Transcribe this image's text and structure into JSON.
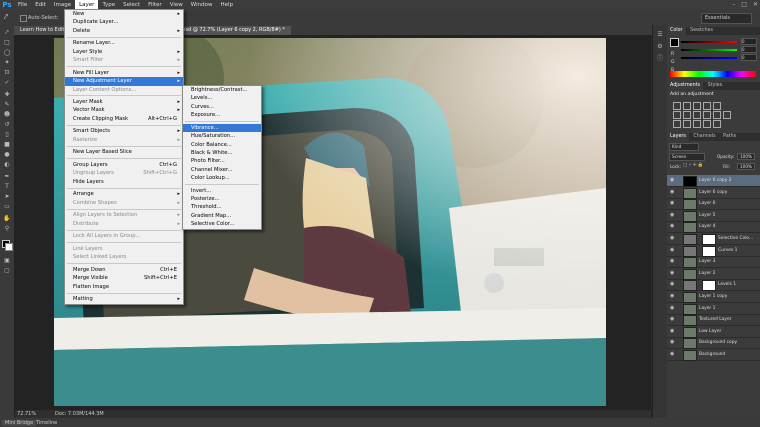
{
  "app": {
    "logo": "Ps"
  },
  "menubar": [
    "File",
    "Edit",
    "Image",
    "Layer",
    "Type",
    "Select",
    "Filter",
    "View",
    "Window",
    "Help"
  ],
  "active_menu": "Layer",
  "options": {
    "auto_select": "Auto-Select:",
    "workspace": "Essentials"
  },
  "document": {
    "tab_left": "Learn How to Edit",
    "tab_right": "ndup.psd @ 72.7% (Layer 6 copy 2, RGB/8#) *",
    "zoom": "72.71%",
    "doc_info": "Doc: 7.03M/144.3M"
  },
  "layer_menu": [
    {
      "label": "New",
      "arrow": true
    },
    {
      "label": "Duplicate Layer..."
    },
    {
      "label": "Delete",
      "arrow": true
    },
    {
      "sep": true
    },
    {
      "label": "Rename Layer..."
    },
    {
      "label": "Layer Style",
      "arrow": true
    },
    {
      "label": "Smart Filter",
      "disabled": true,
      "arrow": true
    },
    {
      "sep": true
    },
    {
      "label": "New Fill Layer",
      "arrow": true
    },
    {
      "label": "New Adjustment Layer",
      "arrow": true,
      "highlight": true
    },
    {
      "label": "Layer Content Options...",
      "disabled": true
    },
    {
      "sep": true
    },
    {
      "label": "Layer Mask",
      "arrow": true
    },
    {
      "label": "Vector Mask",
      "arrow": true
    },
    {
      "label": "Create Clipping Mask",
      "shortcut": "Alt+Ctrl+G"
    },
    {
      "sep": true
    },
    {
      "label": "Smart Objects",
      "arrow": true
    },
    {
      "label": "Rasterize",
      "disabled": true,
      "arrow": true
    },
    {
      "sep": true
    },
    {
      "label": "New Layer Based Slice"
    },
    {
      "sep": true
    },
    {
      "label": "Group Layers",
      "shortcut": "Ctrl+G"
    },
    {
      "label": "Ungroup Layers",
      "shortcut": "Shift+Ctrl+G",
      "disabled": true
    },
    {
      "label": "Hide Layers"
    },
    {
      "sep": true
    },
    {
      "label": "Arrange",
      "arrow": true
    },
    {
      "label": "Combine Shapes",
      "disabled": true,
      "arrow": true
    },
    {
      "sep": true
    },
    {
      "label": "Align Layers to Selection",
      "disabled": true,
      "arrow": true
    },
    {
      "label": "Distribute",
      "disabled": true,
      "arrow": true
    },
    {
      "sep": true
    },
    {
      "label": "Lock All Layers in Group...",
      "disabled": true
    },
    {
      "sep": true
    },
    {
      "label": "Link Layers",
      "disabled": true
    },
    {
      "label": "Select Linked Layers",
      "disabled": true
    },
    {
      "sep": true
    },
    {
      "label": "Merge Down",
      "shortcut": "Ctrl+E"
    },
    {
      "label": "Merge Visible",
      "shortcut": "Shift+Ctrl+E"
    },
    {
      "label": "Flatten Image"
    },
    {
      "sep": true
    },
    {
      "label": "Matting",
      "arrow": true
    }
  ],
  "adjustment_submenu": [
    {
      "label": "Brightness/Contrast..."
    },
    {
      "label": "Levels..."
    },
    {
      "label": "Curves..."
    },
    {
      "label": "Exposure..."
    },
    {
      "sep": true
    },
    {
      "label": "Vibrance...",
      "highlight": true
    },
    {
      "label": "Hue/Saturation..."
    },
    {
      "label": "Color Balance..."
    },
    {
      "label": "Black & White..."
    },
    {
      "label": "Photo Filter..."
    },
    {
      "label": "Channel Mixer..."
    },
    {
      "label": "Color Lookup..."
    },
    {
      "sep": true
    },
    {
      "label": "Invert..."
    },
    {
      "label": "Posterize..."
    },
    {
      "label": "Threshold..."
    },
    {
      "label": "Gradient Map..."
    },
    {
      "label": "Selective Color..."
    }
  ],
  "color_panel": {
    "tabs": [
      "Color",
      "Swatches"
    ],
    "r_label": "R",
    "g_label": "G",
    "b_label": "B",
    "r": "0",
    "g": "0",
    "b": "0"
  },
  "adjustments_panel": {
    "tabs": [
      "Adjustments",
      "Styles"
    ],
    "hint": "Add an adjustment"
  },
  "layers_panel": {
    "tabs": [
      "Layers",
      "Channels",
      "Paths"
    ],
    "kind": "Kind",
    "blend": "Screen",
    "opacity_label": "Opacity:",
    "opacity": "100%",
    "lock_label": "Lock:",
    "fill_label": "Fill:",
    "fill": "100%",
    "layers": [
      {
        "name": "Layer 6 copy 2",
        "selected": true
      },
      {
        "name": "Layer 6 copy"
      },
      {
        "name": "Layer 6"
      },
      {
        "name": "Layer 5"
      },
      {
        "name": "Layer 4"
      },
      {
        "name": "Selective Colo...",
        "mask": true
      },
      {
        "name": "Curves 1",
        "mask": true
      },
      {
        "name": "Layer 3"
      },
      {
        "name": "Layer 2"
      },
      {
        "name": "Levels 1",
        "mask": true
      },
      {
        "name": "Layer 1 copy"
      },
      {
        "name": "Layer 1"
      },
      {
        "name": "Textured Layer"
      },
      {
        "name": "Low Layer"
      },
      {
        "name": "Background copy"
      },
      {
        "name": "Background"
      }
    ]
  },
  "bottom_tabs": [
    "Mini Bridge",
    "Timeline"
  ],
  "colors": {
    "highlight": "#3478d6",
    "selected_layer": "#5b6c80",
    "truck": "#48b8b6"
  }
}
